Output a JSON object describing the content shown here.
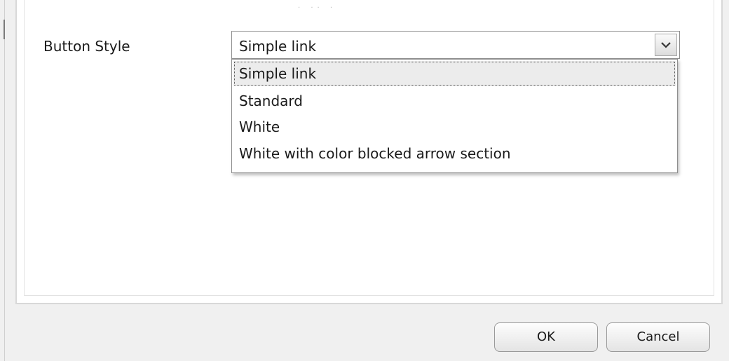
{
  "form": {
    "button_style_label": "Button Style",
    "button_style_value": "Simple link",
    "options": [
      {
        "label": "Simple link",
        "selected": true
      },
      {
        "label": "Standard",
        "selected": false
      },
      {
        "label": "White",
        "selected": false
      },
      {
        "label": "White with color blocked arrow section",
        "selected": false
      }
    ]
  },
  "footer": {
    "ok_label": "OK",
    "cancel_label": "Cancel"
  },
  "icons": {
    "dropdown_arrow": "chevron-down-icon"
  }
}
